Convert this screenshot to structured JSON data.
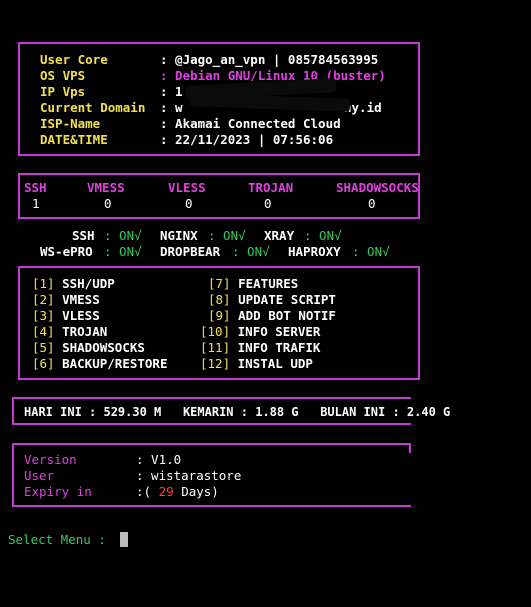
{
  "colors": {
    "background": "#000000",
    "frame": "#c33bcf",
    "label_yellow": "#f4e04d",
    "os_magenta": "#e040e0",
    "status_green": "#39c85a",
    "days_red": "#ff3b3b"
  },
  "info": {
    "user_core_label": "User Core",
    "user_core_value": ": @Jago_an_vpn | 085784563995",
    "os_label": "OS VPS",
    "os_value": ": Debian GNU/Linux 10 (buster)",
    "ip_label": "IP Vps",
    "ip_value": ": 1",
    "domain_label": "Current Domain",
    "domain_value_start": ": w",
    "domain_value_end": "ny.id",
    "isp_label": "ISP-Name",
    "isp_value": ": Akamai Connected Cloud",
    "datetime_label": "DATE&TIME",
    "datetime_value": ": 22/11/2023 | 07:56:06"
  },
  "accounts": {
    "headers": [
      "SSH",
      "VMESS",
      "VLESS",
      "TROJAN",
      "SHADOWSOCKS"
    ],
    "counts": [
      "1",
      "0",
      "0",
      "0",
      "0"
    ]
  },
  "services": {
    "ssh_label": "SSH",
    "ssh_status": ": ON√",
    "nginx_label": "NGINX",
    "nginx_status": ": ON√",
    "xray_label": "XRAY",
    "xray_status": ": ON√",
    "wspro_label": "WS-ePRO",
    "wspro_status": ": ON√",
    "dropbear_label": "DROPBEAR",
    "dropbear_status": ": ON√",
    "haproxy_label": "HAPROXY",
    "haproxy_status": ": ON√"
  },
  "menu": {
    "left": [
      {
        "num": "[1]",
        "label": "SSH/UDP"
      },
      {
        "num": "[2]",
        "label": "VMESS"
      },
      {
        "num": "[3]",
        "label": "VLESS"
      },
      {
        "num": "[4]",
        "label": "TROJAN"
      },
      {
        "num": "[5]",
        "label": "SHADOWSOCKS"
      },
      {
        "num": "[6]",
        "label": "BACKUP/RESTORE"
      }
    ],
    "right": [
      {
        "num": "[7]",
        "label": "FEATURES"
      },
      {
        "num": "[8]",
        "label": "UPDATE SCRIPT"
      },
      {
        "num": "[9]",
        "label": "ADD BOT NOTIF"
      },
      {
        "num": "[10]",
        "label": "INFO SERVER"
      },
      {
        "num": "[11]",
        "label": "INFO TRAFIK"
      },
      {
        "num": "[12]",
        "label": "INSTAL UDP"
      }
    ]
  },
  "bandwidth": {
    "text": "HARI INI : 529.30 M   KEMARIN : 1.88 G   BULAN INI : 2.40 G"
  },
  "license": {
    "version_label": "Version",
    "version_value": ": V1.0",
    "user_label": "User",
    "user_value": ": wistarastore",
    "expiry_label": "Expiry in",
    "expiry_prefix": ":(",
    "expiry_days": "29",
    "expiry_suffix": "Days)"
  },
  "prompt": {
    "label": "Select Menu :"
  }
}
